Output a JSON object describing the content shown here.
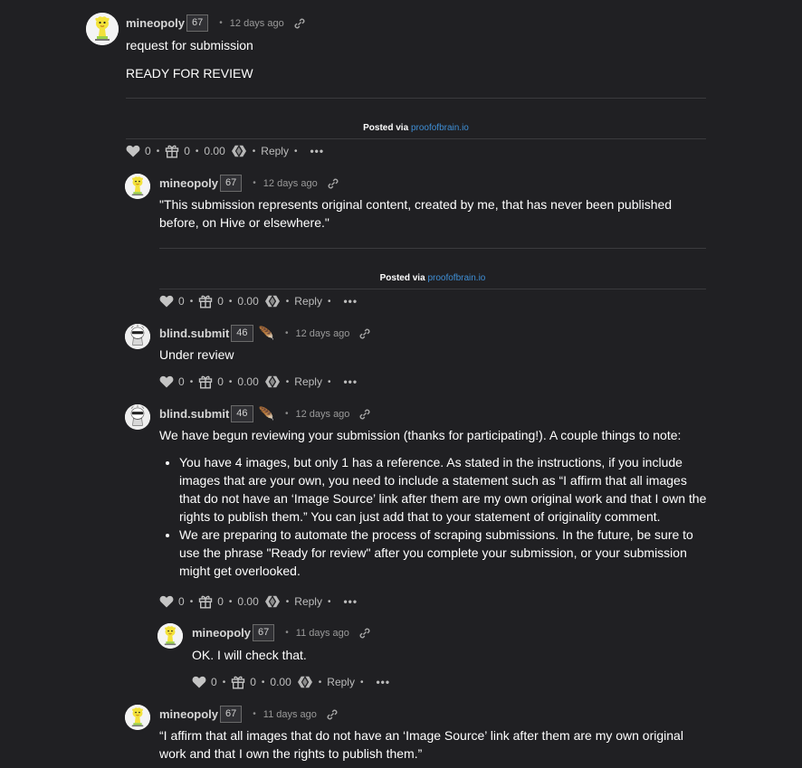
{
  "accent_link_color": "#3f8fd6",
  "comments": [
    {
      "author": "mineopoly",
      "reputation": "67",
      "time": "12 days ago",
      "paragraphs": [
        "request for submission",
        "READY FOR REVIEW"
      ],
      "posted_via_label": "Posted via",
      "posted_via_link": "proofofbrain.io",
      "votes": "0",
      "gifts": "0",
      "payout": "0.00",
      "reply_label": "Reply",
      "more_label": "•••"
    },
    {
      "author": "mineopoly",
      "reputation": "67",
      "time": "12 days ago",
      "paragraphs": [
        "\"This submission represents original content, created by me, that has never been published before, on Hive or elsewhere.\""
      ],
      "posted_via_label": "Posted via",
      "posted_via_link": "proofofbrain.io",
      "votes": "0",
      "gifts": "0",
      "payout": "0.00",
      "reply_label": "Reply",
      "more_label": "•••"
    },
    {
      "author": "blind.submit",
      "reputation": "46",
      "time": "12 days ago",
      "paragraphs": [
        "Under review"
      ],
      "votes": "0",
      "gifts": "0",
      "payout": "0.00",
      "reply_label": "Reply",
      "more_label": "•••"
    },
    {
      "author": "blind.submit",
      "reputation": "46",
      "time": "12 days ago",
      "paragraphs": [
        "We have begun reviewing your submission (thanks for participating!). A couple things to note:"
      ],
      "bullets": [
        "You have 4 images, but only 1 has a reference. As stated in the instructions, if you include images that are your own, you need to include a statement such as “I affirm that all images that do not have an ‘Image Source’ link after them are my own original work and that I own the rights to publish them.” You can just add that to your statement of originality comment.",
        "We are preparing to automate the process of scraping submissions. In the future, be sure to use the phrase \"Ready for review\" after you complete your submission, or your submission might get overlooked."
      ],
      "votes": "0",
      "gifts": "0",
      "payout": "0.00",
      "reply_label": "Reply",
      "more_label": "•••"
    },
    {
      "author": "mineopoly",
      "reputation": "67",
      "time": "11 days ago",
      "paragraphs": [
        "OK. I will check that."
      ],
      "votes": "0",
      "gifts": "0",
      "payout": "0.00",
      "reply_label": "Reply",
      "more_label": "•••"
    },
    {
      "author": "mineopoly",
      "reputation": "67",
      "time": "11 days ago",
      "paragraphs": [
        "“I affirm that all images that do not have an ‘Image Source’ link after them are my own original work and that I own the rights to publish them.”"
      ]
    }
  ]
}
